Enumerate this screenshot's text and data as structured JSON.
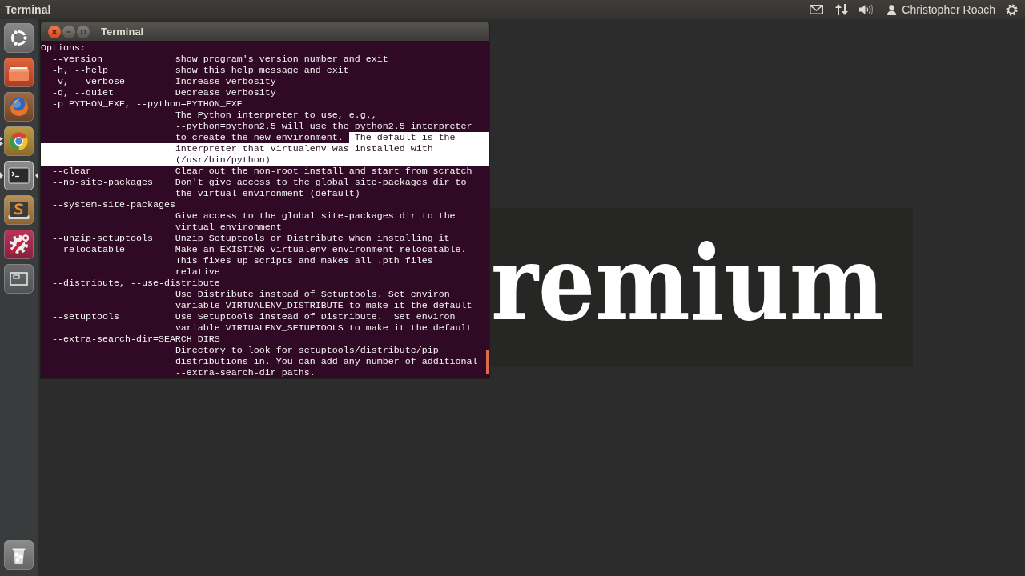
{
  "top_panel": {
    "app_name": "Terminal",
    "user_name": "Christopher Roach"
  },
  "launcher": {
    "items": [
      {
        "kind": "home",
        "running": false,
        "multiple_windows": false,
        "focused": false
      },
      {
        "kind": "folder",
        "running": false,
        "multiple_windows": false,
        "focused": false
      },
      {
        "kind": "globe",
        "running": false,
        "multiple_windows": false,
        "focused": false
      },
      {
        "kind": "wheel",
        "running": true,
        "multiple_windows": true,
        "focused": false
      },
      {
        "kind": "terminal",
        "running": true,
        "multiple_windows": false,
        "focused": true
      },
      {
        "kind": "editor",
        "running": false,
        "multiple_windows": false,
        "focused": false
      },
      {
        "kind": "settings",
        "running": false,
        "multiple_windows": false,
        "focused": false
      },
      {
        "kind": "workspaces",
        "running": false,
        "multiple_windows": false,
        "focused": false
      },
      {
        "kind": "trash",
        "running": false,
        "multiple_windows": false,
        "focused": false
      }
    ]
  },
  "wallpaper": {
    "text": "remium"
  },
  "terminal": {
    "title": "Terminal",
    "lines": [
      {
        "heading": "Options:",
        "selected": false
      },
      {
        "option": "--version",
        "description": "show program's version number and exit",
        "selected": false
      },
      {
        "option": "-h, --help",
        "description": "show this help message and exit",
        "selected": false
      },
      {
        "option": "-v, --verbose",
        "description": "Increase verbosity",
        "selected": false
      },
      {
        "option": "-q, --quiet",
        "description": "Decrease verbosity",
        "selected": false
      },
      {
        "option": "-p PYTHON_EXE, --python=PYTHON_EXE",
        "selected": false
      },
      {
        "description": "The Python interpreter to use, e.g.,",
        "selected": false
      },
      {
        "description": "--python=python2.5 will use the python2.5 interpreter",
        "selected": false
      },
      {
        "description": "to create the new environment.",
        "selection": "The default is the",
        "selected": false
      },
      {
        "description": "interpreter that virtualenv was installed with",
        "selected": true
      },
      {
        "description": "(/usr/bin/python)",
        "selected": true
      },
      {
        "option": "--clear",
        "description": "Clear out the non-root install and start from scratch",
        "selected": false
      },
      {
        "option": "--no-site-packages",
        "description": "Don't give access to the global site-packages dir to",
        "selected": false
      },
      {
        "description": "the virtual environment (default)",
        "selected": false
      },
      {
        "option": "--system-site-packages",
        "selected": false
      },
      {
        "description": "Give access to the global site-packages dir to the",
        "selected": false
      },
      {
        "description": "virtual environment",
        "selected": false
      },
      {
        "option": "--unzip-setuptools",
        "description": "Unzip Setuptools or Distribute when installing it",
        "selected": false
      },
      {
        "option": "--relocatable",
        "description": "Make an EXISTING virtualenv environment relocatable.",
        "selected": false
      },
      {
        "description": "This fixes up scripts and makes all .pth files",
        "selected": false
      },
      {
        "description": "relative",
        "selected": false
      },
      {
        "option": "--distribute, --use-distribute",
        "selected": false
      },
      {
        "description": "Use Distribute instead of Setuptools. Set environ",
        "selected": false
      },
      {
        "description": "variable VIRTUALENV_DISTRIBUTE to make it the default",
        "selected": false
      },
      {
        "option": "--setuptools",
        "description": "Use Setuptools instead of Distribute.  Set environ",
        "selected": false
      },
      {
        "description": "variable VIRTUALENV_SETUPTOOLS to make it the default",
        "selected": false
      },
      {
        "option": "--extra-search-dir=SEARCH_DIRS",
        "selected": false
      },
      {
        "description": "Directory to look for setuptools/distribute/pip",
        "selected": false
      },
      {
        "description": "distributions in. You can add any number of additional",
        "selected": false
      },
      {
        "description": "--extra-search-dir paths.",
        "selected": false
      }
    ]
  }
}
